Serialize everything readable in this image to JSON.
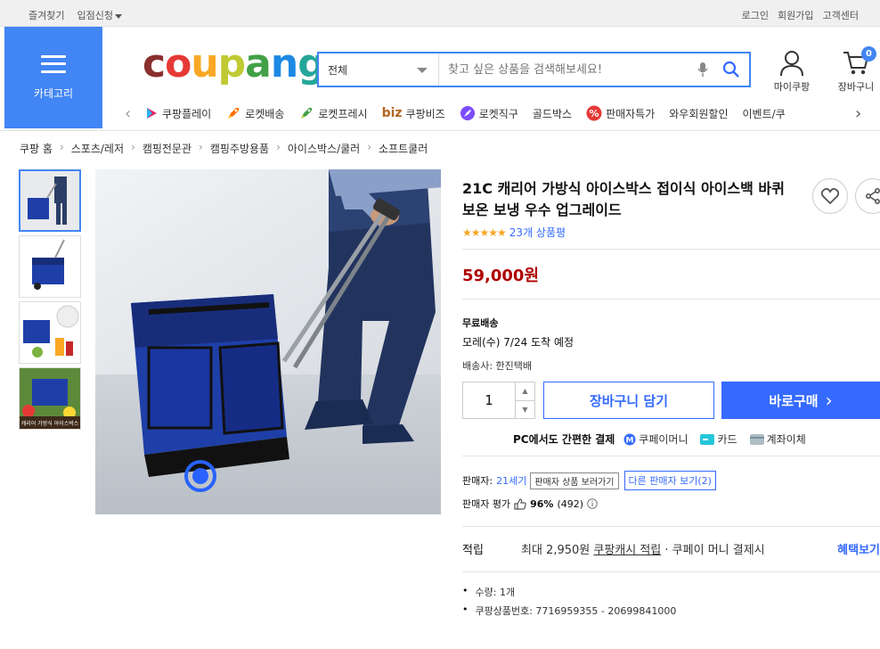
{
  "topbar": {
    "left": [
      "즐겨찾기",
      "입점신청"
    ],
    "right": [
      "로그인",
      "회원가입",
      "고객센터"
    ]
  },
  "category": {
    "label": "카테고리"
  },
  "logo": {
    "text": "coupang"
  },
  "search": {
    "category": "전체",
    "placeholder": "찾고 싶은 상품을 검색해보세요!"
  },
  "header_icons": {
    "mypage": "마이쿠팡",
    "cart": "장바구니",
    "cart_count": "0"
  },
  "nav": {
    "items": [
      {
        "label": "쿠팡플레이",
        "color": "#e91e63"
      },
      {
        "label": "로켓배송",
        "color": "#ff6f00"
      },
      {
        "label": "로켓프레시",
        "color": "#4caf50"
      },
      {
        "label": "쿠팡비즈",
        "prefix": "biz",
        "color": "#b5651d"
      },
      {
        "label": "로켓직구",
        "color": "#7c4dff"
      },
      {
        "label": "골드박스",
        "color": ""
      },
      {
        "label": "판매자특가",
        "color": "#e53935"
      },
      {
        "label": "와우회원할인",
        "color": ""
      },
      {
        "label": "이벤트/쿠",
        "color": ""
      }
    ]
  },
  "breadcrumb": [
    "쿠팡 홈",
    "스포츠/레저",
    "캠핑전문관",
    "캠핑주방용품",
    "아이스박스/쿨러",
    "소프트쿨러"
  ],
  "thumbs": [
    {
      "caption": ""
    },
    {
      "caption": ""
    },
    {
      "caption": ""
    },
    {
      "caption": "캐리어 가방식 아이스박스"
    }
  ],
  "product": {
    "title": "21C 캐리어 가방식 아이스박스 접이식 아이스백 바퀴 보온 보냉 우수 업그레이드",
    "rating": 4.5,
    "stars": "★★★★★",
    "review_count": "23개 상품평",
    "price": "59,000원",
    "shipping_label": "무료배송",
    "arrival": "모레(수) 7/24 도착 예정",
    "carrier": "배송사: 한진택배",
    "quantity": "1",
    "cart_button": "장바구니 담기",
    "buy_button": "바로구매"
  },
  "payment": {
    "label": "PC에서도 간편한 결제",
    "methods": [
      "쿠페이머니",
      "카드",
      "계좌이체"
    ]
  },
  "seller": {
    "prefix": "판매자:",
    "name": "21세기",
    "tag": "판매자 상품 보러가기",
    "other": "다른 판매자 보기(2)",
    "eval_label": "판매자 평가",
    "eval_pct": "96%",
    "eval_count": "(492)"
  },
  "benefit": {
    "label": "적립",
    "text1": "최대 2,950원 ",
    "link": "쿠팡캐시 적립",
    "text2": " · 쿠페이 머니 결제시",
    "more": "혜택보기"
  },
  "details": [
    "수량: 1개",
    "쿠팡상품번호: 7716959355 - 20699841000"
  ],
  "colors": {
    "accent": "#346aff",
    "category_bg": "#4285f4",
    "price": "#ae0000"
  }
}
